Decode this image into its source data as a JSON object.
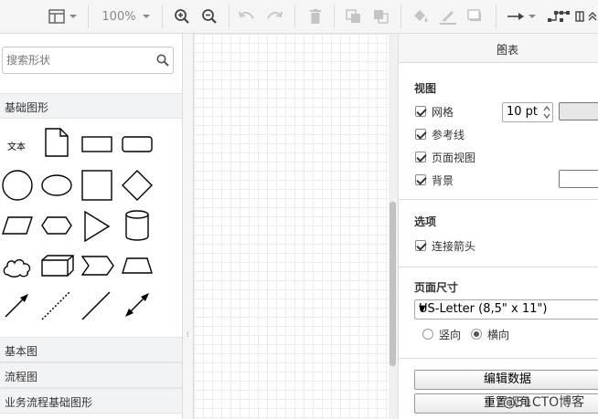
{
  "toolbar": {
    "zoom": "100%",
    "icons": [
      "format-panel-icon",
      "chevron-down-icon",
      "zoom-in-icon",
      "zoom-out-icon",
      "undo-icon",
      "redo-icon",
      "delete-icon",
      "to-front-icon",
      "to-back-icon",
      "fill-color-icon",
      "line-color-icon",
      "shadow-icon",
      "connection-arrow-icon",
      "waypoints-icon",
      "collapse-icon"
    ]
  },
  "search": {
    "placeholder": "搜索形状"
  },
  "left": {
    "general_category": "基础图形",
    "text_shape_label": "文本",
    "categories": [
      "基本图",
      "流程图",
      "业务流程基础图形"
    ]
  },
  "right": {
    "title": "图表",
    "close": "✕",
    "view": {
      "title": "视图",
      "grid_label": "网格",
      "grid_size": "10 pt",
      "guides_label": "参考线",
      "page_view_label": "页面视图",
      "background_label": "背景"
    },
    "options": {
      "title": "选项",
      "connection_arrows_label": "连接箭头"
    },
    "page_size": {
      "title": "页面尺寸",
      "selected": "US-Letter (8,5\" x 11\")",
      "portrait_label": "竖向",
      "landscape_label": "横向",
      "orientation": "landscape"
    },
    "edit_data_button": "编辑数据",
    "reset_view_button": "重置视角",
    "grid_color": "#e6e6e6",
    "background_color": "#ffffff"
  },
  "watermark": "@51CTO博客"
}
